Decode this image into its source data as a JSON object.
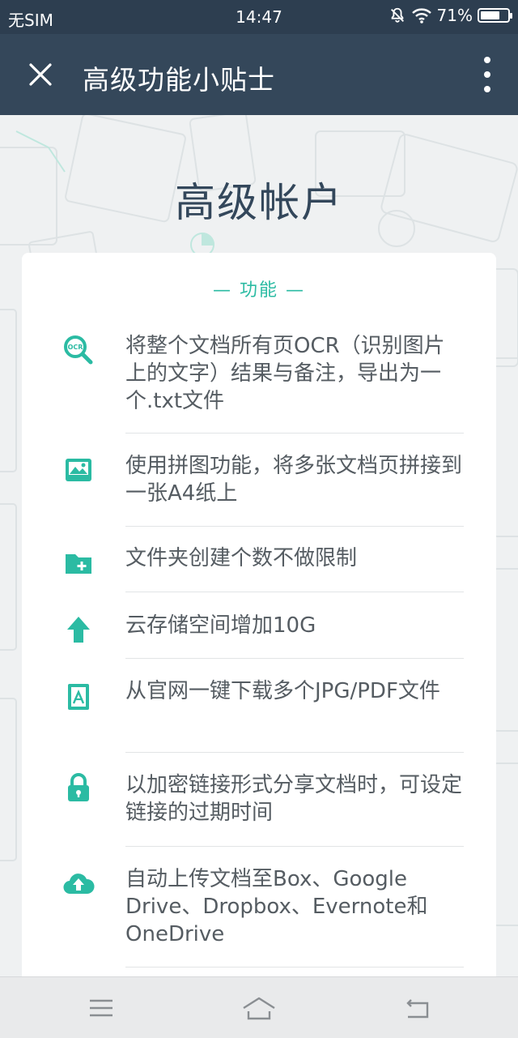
{
  "status_bar": {
    "carrier": "无SIM",
    "time": "14:47",
    "battery_percent": "71%",
    "battery_level": 0.71,
    "icons": [
      "mute-icon",
      "wifi-icon",
      "battery-icon"
    ]
  },
  "app_bar": {
    "title": "高级功能小贴士",
    "close_icon": "close-icon",
    "menu_icon": "more-vert-icon"
  },
  "hero": {
    "title": "高级帐户"
  },
  "card": {
    "header": "— 功能 —",
    "features": [
      {
        "icon": "ocr-search-icon",
        "text": "将整个文档所有页OCR（识别图片上的文字）结果与备注，导出为一个.txt文件"
      },
      {
        "icon": "image-collage-icon",
        "text": "使用拼图功能，将多张文档页拼接到一张A4纸上"
      },
      {
        "icon": "folder-add-icon",
        "text": "文件夹创建个数不做限制"
      },
      {
        "icon": "arrow-up-icon",
        "text": "云存储空间增加10G"
      },
      {
        "icon": "pdf-file-icon",
        "text": "从官网一键下载多个JPG/PDF文件"
      },
      {
        "icon": "lock-icon",
        "text": "以加密链接形式分享文档时，可设定链接的过期时间"
      },
      {
        "icon": "cloud-upload-icon",
        "text": "自动上传文档至Box、Google Drive、Dropbox、Evernote和OneDrive"
      }
    ]
  },
  "nav_bar": {
    "icons": [
      "menu-icon",
      "home-icon",
      "back-icon"
    ]
  },
  "colors": {
    "status_bar": "#2d3e50",
    "app_bar": "#34475a",
    "accent": "#2bbba3",
    "title_text": "#33475b",
    "body_text": "#555c62"
  }
}
